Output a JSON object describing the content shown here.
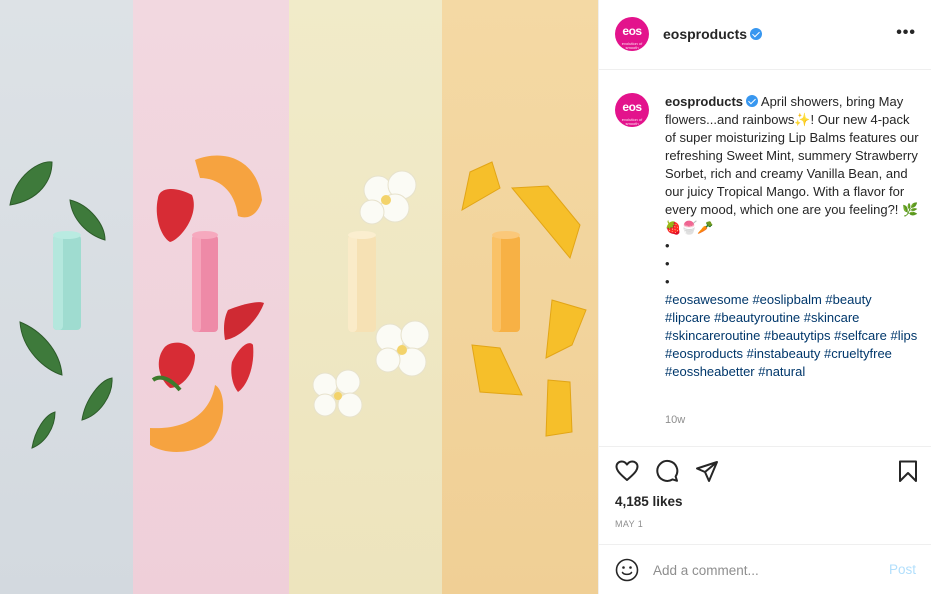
{
  "post": {
    "image_description_icon": "eos-lip-balm-photo",
    "colors": {
      "brand": "#e3138c",
      "link": "#00376b",
      "verified": "#3897f0",
      "muted": "#8e8e8e",
      "post_disabled": "#b2dffc"
    }
  },
  "header": {
    "avatar_text": "eos",
    "avatar_sub": "evolution of smooth",
    "username": "eosproducts",
    "more_label": "•••"
  },
  "caption": {
    "username": "eosproducts",
    "text_1": " April showers, bring May flowers...and rainbows",
    "emoji_1": "✨",
    "text_2": "! Our new 4-pack of super moisturizing Lip Balms features our refreshing Sweet Mint, summery Strawberry Sorbet, rich and creamy Vanilla Bean, and our juicy Tropical Mango. With a flavor for every mood, which one are you feeling?! ",
    "emoji_2": "🌿🍓🍧🥕",
    "dots": [
      "•",
      "•",
      "•"
    ],
    "hashtags": "#eosawesome #eoslipbalm #beauty #lipcare #beautyroutine #skincare #skincareroutine #beautytips #selfcare #lips #eosproducts #instabeauty #crueltyfree #eossheabetter #natural",
    "age": "10w"
  },
  "actions": {
    "like_icon": "heart-icon",
    "comment_icon": "comment-icon",
    "share_icon": "paper-plane-icon",
    "save_icon": "bookmark-icon"
  },
  "likes": "4,185 likes",
  "date": "MAY 1",
  "comment": {
    "emoji_icon": "smiley-icon",
    "placeholder": "Add a comment...",
    "post_label": "Post"
  }
}
